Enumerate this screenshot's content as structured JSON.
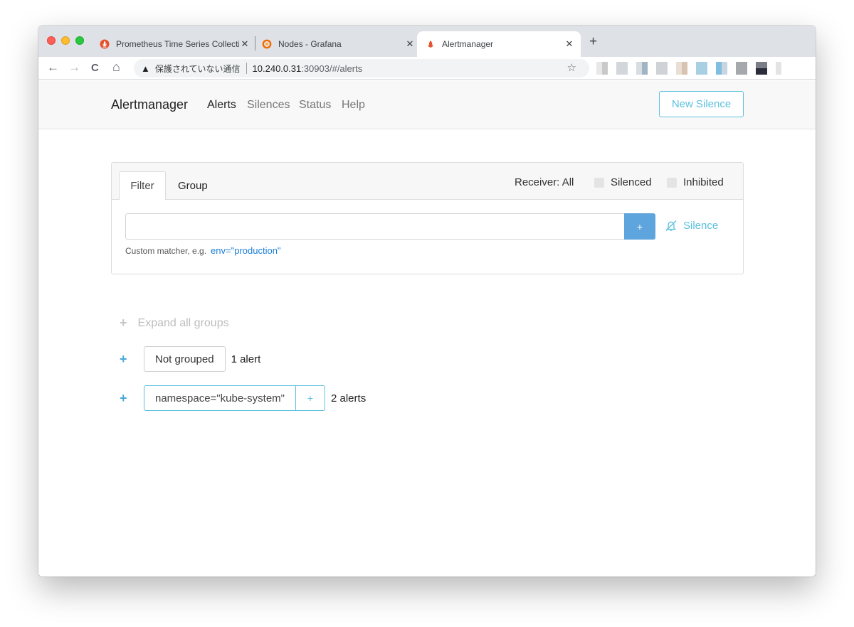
{
  "browser": {
    "tabs": [
      {
        "title": "Prometheus Time Series Collection and Processing Server",
        "close": "✕"
      },
      {
        "title": "Nodes - Grafana",
        "close": "✕"
      },
      {
        "title": "Alertmanager",
        "close": "✕"
      }
    ],
    "new_tab": "+",
    "nav": {
      "back": "←",
      "forward": "→",
      "reload": "C",
      "home": "⌂"
    },
    "address": {
      "warning_icon": "▲",
      "security_text": "保護されていない通信",
      "host": "10.240.0.31",
      "path": ":30903/#/alerts"
    },
    "bookmark_icon": "☆"
  },
  "app": {
    "brand": "Alertmanager",
    "nav": [
      {
        "label": "Alerts",
        "active": true
      },
      {
        "label": "Silences",
        "active": false
      },
      {
        "label": "Status",
        "active": false
      },
      {
        "label": "Help",
        "active": false
      }
    ],
    "new_silence_label": "New Silence"
  },
  "filter": {
    "tabs": {
      "filter": "Filter",
      "group": "Group"
    },
    "receiver": "Receiver: All",
    "silenced_label": "Silenced",
    "inhibited_label": "Inhibited",
    "input_value": "",
    "add_label": "+",
    "silence_label": "Silence",
    "hint": "Custom matcher, e.g.",
    "hint_example": "env=\"production\""
  },
  "groups": {
    "expand_all": "Expand all groups",
    "expand_icon": "+",
    "items": [
      {
        "label": "Not grouped",
        "count": "1 alert"
      },
      {
        "label": "namespace=\"kube-system\"",
        "add": "+",
        "count": "2 alerts"
      }
    ]
  },
  "colors": {
    "accent": "#5bc0de",
    "primary_button": "#5da5dc",
    "link": "#1c7ed6"
  }
}
